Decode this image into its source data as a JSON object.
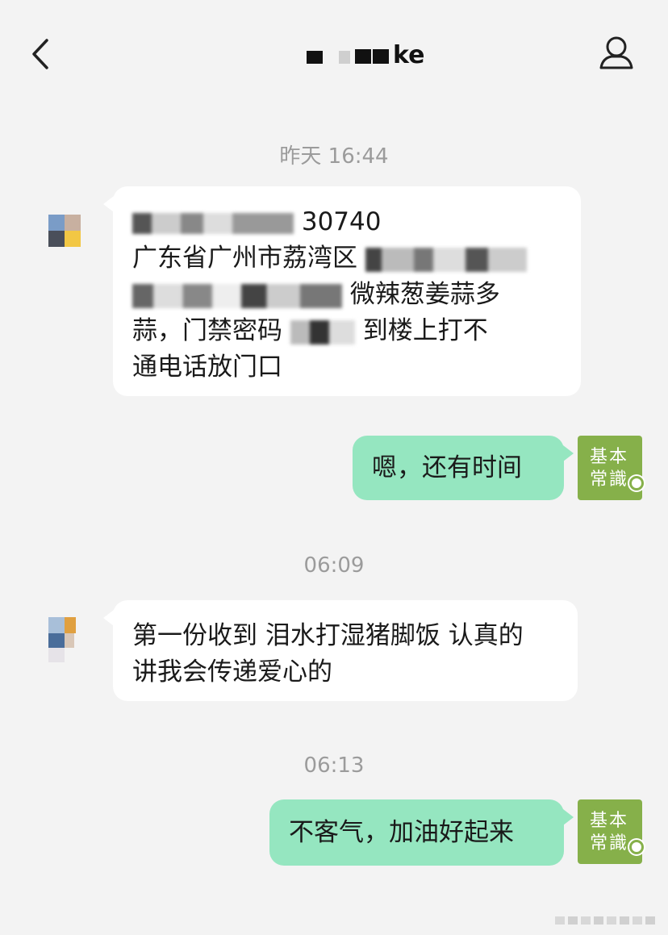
{
  "header": {
    "contact_name_suffix": "ke",
    "back_icon": "chevron-left-icon",
    "profile_icon": "person-icon"
  },
  "timestamps": [
    "昨天 16:44",
    "06:09",
    "06:13"
  ],
  "messages": [
    {
      "side": "left",
      "lines": [
        "30740",
        "广东省广州市荔湾区",
        "微辣葱姜蒜多",
        "蒜，门禁密码",
        "到楼上打不",
        "通电话放门口"
      ]
    },
    {
      "side": "right",
      "text": "嗯，还有时间"
    },
    {
      "side": "left",
      "lines": [
        "第一份收到 泪水打湿猪脚饭 认真的",
        "讲我会传递爱心的"
      ]
    },
    {
      "side": "right",
      "text": "不客气，加油好起来"
    }
  ],
  "my_avatar": {
    "line1": "基本",
    "line2": "常識"
  },
  "colors": {
    "background": "#f3f3f3",
    "outgoing_bubble": "#95e6c0",
    "incoming_bubble": "#ffffff",
    "avatar_green": "#86b04a"
  }
}
